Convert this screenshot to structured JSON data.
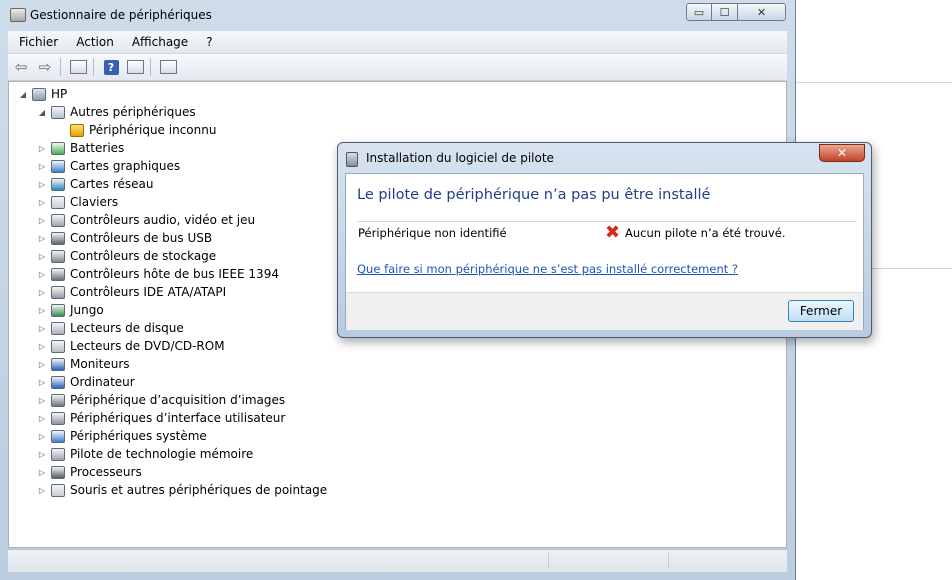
{
  "window": {
    "title": "Gestionnaire de périphériques",
    "controls": {
      "minimize": "▭",
      "maximize": "☐",
      "close": "✕"
    }
  },
  "menu": {
    "items": [
      "Fichier",
      "Action",
      "Affichage",
      "?"
    ]
  },
  "toolbar": {
    "buttons": [
      "back-arrow-icon",
      "forward-arrow-icon",
      "properties-icon",
      "help-icon",
      "view-icon",
      "scan-hardware-icon"
    ],
    "back_glyph": "⇦",
    "forward_glyph": "⇨",
    "help_glyph": "?"
  },
  "tree": {
    "root": "HP",
    "nodes": [
      {
        "label": "Autres périphériques",
        "expanded": true,
        "icon": "unknown-device-icon"
      },
      {
        "label": "Périphérique inconnu",
        "child": true,
        "icon": "warning-device-icon"
      },
      {
        "label": "Batteries",
        "icon": "battery-icon"
      },
      {
        "label": "Cartes graphiques",
        "icon": "display-adapter-icon"
      },
      {
        "label": "Cartes réseau",
        "icon": "network-adapter-icon"
      },
      {
        "label": "Claviers",
        "icon": "keyboard-icon"
      },
      {
        "label": "Contrôleurs audio, vidéo et jeu",
        "icon": "speaker-icon"
      },
      {
        "label": "Contrôleurs de bus USB",
        "icon": "usb-icon"
      },
      {
        "label": "Contrôleurs de stockage",
        "icon": "storage-controller-icon"
      },
      {
        "label": "Contrôleurs hôte de bus IEEE 1394",
        "icon": "firewire-icon"
      },
      {
        "label": "Contrôleurs IDE ATA/ATAPI",
        "icon": "ide-controller-icon"
      },
      {
        "label": "Jungo",
        "icon": "jungo-device-icon"
      },
      {
        "label": "Lecteurs de disque",
        "icon": "disk-drive-icon"
      },
      {
        "label": "Lecteurs de DVD/CD-ROM",
        "icon": "dvd-drive-icon"
      },
      {
        "label": "Moniteurs",
        "icon": "monitor-icon"
      },
      {
        "label": "Ordinateur",
        "icon": "computer-icon"
      },
      {
        "label": "Périphérique d’acquisition d’images",
        "icon": "camera-icon"
      },
      {
        "label": "Périphériques d’interface utilisateur",
        "icon": "hid-icon"
      },
      {
        "label": "Périphériques système",
        "icon": "system-device-icon"
      },
      {
        "label": "Pilote de technologie mémoire",
        "icon": "memory-icon"
      },
      {
        "label": "Processeurs",
        "icon": "processor-icon"
      },
      {
        "label": "Souris et autres périphériques de pointage",
        "icon": "mouse-icon"
      }
    ],
    "colors": {
      "battery-icon": "#4caf50",
      "display-adapter-icon": "#3f7fd0",
      "network-adapter-icon": "#2e86c1",
      "keyboard-icon": "#c9cfd6",
      "speaker-icon": "#9aa5b1",
      "usb-icon": "#5c6670",
      "storage-controller-icon": "#7d8893",
      "firewire-icon": "#6a737c",
      "ide-controller-icon": "#8e9aa6",
      "jungo-device-icon": "#3b8f4a",
      "disk-drive-icon": "#a7b0ba",
      "dvd-drive-icon": "#b5bdc6",
      "monitor-icon": "#2a63b8",
      "computer-icon": "#2a63b8",
      "camera-icon": "#6d7882",
      "hid-icon": "#8a96a2",
      "system-device-icon": "#3f7fd0",
      "memory-icon": "#9aa4ae",
      "processor-icon": "#555e66",
      "mouse-icon": "#c6ccd3",
      "unknown-device-icon": "#b9c2cc"
    }
  },
  "dialog": {
    "title": "Installation du logiciel de pilote",
    "close_glyph": "✕",
    "heading": "Le pilote de périphérique n’a pas pu être installé",
    "device": "Périphérique non identifié",
    "error_glyph": "✖",
    "status": "Aucun pilote n’a été trouvé.",
    "link": "Que faire si mon périphérique ne s’est pas installé correctement ?",
    "button": "Fermer"
  }
}
